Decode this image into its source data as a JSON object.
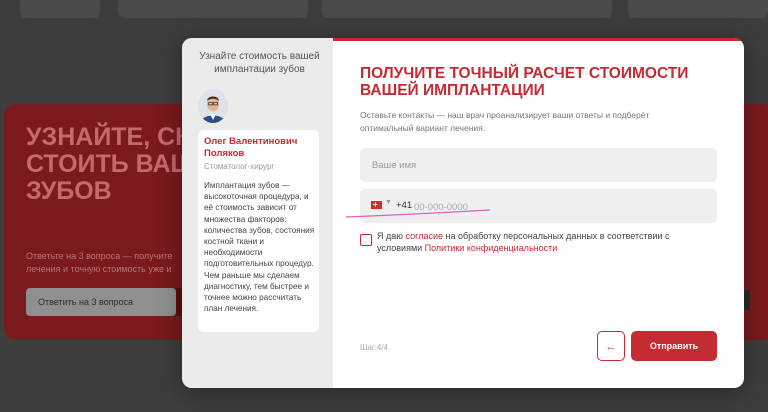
{
  "background": {
    "promo_title": "УЗНАЙТЕ, СК\nСТОИТЬ ВАШ\nЗУБОВ",
    "promo_text": "Ответьте на 3 вопроса — получите лечения и точную стоимость уже и",
    "promo_button": "Ответить на 3 вопроса"
  },
  "sidebar": {
    "title": "Узнайте стоимость вашей имплантации зубов",
    "doctor_name": "Олег Валентинович Поляков",
    "doctor_role": "Стоматолог-хирург",
    "doctor_text": "Имплантация зубов — высокоточная процедура, и её стоимость зависит от множества факторов: количества зубов, состояния костной ткани и необходимости подготовительных процедур. Чем раньше мы сделаем диагностику, тем быстрее и точнее можно рассчитать план лечения."
  },
  "form": {
    "title": "ПОЛУЧИТЕ ТОЧНЫЙ РАСЧЕТ СТОИМОСТИ ВАШЕЙ ИМПЛАНТАЦИИ",
    "description": "Оставьте контакты — наш врач проанализирует ваши ответы и подберёт оптимальный вариант лечения.",
    "name_placeholder": "Ваше имя",
    "phone_code": "+41",
    "phone_placeholder": "00-000-0000",
    "consent_prefix": "Я даю ",
    "consent_link1": "согласие",
    "consent_middle": " на обработку персональных данных в соответствии с условиями ",
    "consent_link2": "Политики конфиденциальности",
    "step_label": "Шаг:4/4",
    "back_icon": "←",
    "submit_label": "Отправить"
  },
  "colors": {
    "accent": "#c42b32",
    "overlay": "#3d3d3d"
  }
}
